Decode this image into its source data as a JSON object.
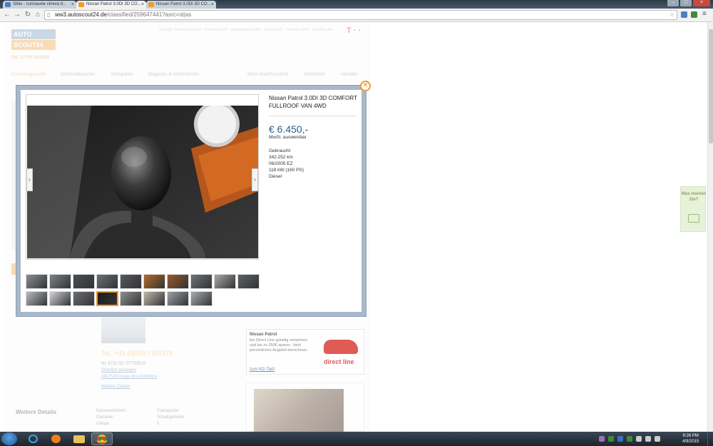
{
  "browser": {
    "tabs": [
      {
        "label": "Sibiu - curioasele cineva d..."
      },
      {
        "label": "Nissan Patrol 3.0DI 3D CO..."
      },
      {
        "label": "Nissan Patrol 3.0DI 3D CO..."
      }
    ],
    "url_host": "ww3.autoscout24.de",
    "url_path": "/classified/259647441?asrc=st|as"
  },
  "site": {
    "logo_top": "AUTO",
    "logo_bottom": "SCOUT24",
    "slogan": "DIE 1 FÜR DEINEN",
    "nav": [
      "Fahrzeugsuche",
      "Werkstattsuche",
      "Verkaufen",
      "Magazin & Informieren",
      "Mein AutoScout24",
      "Werkstatt",
      "Händler"
    ],
    "dealer": {
      "phone": "Tel.: +31 (0)318 / 591275",
      "address": "NL 6731 SC OTTERLO",
      "link1": "Standort anzeigen",
      "link2": "Alle Fahrzeuge des Anbieters",
      "link3": "Weitere Details"
    },
    "weitere_details": "Weitere Details",
    "specs": [
      {
        "k": "Karosserieform:",
        "v": "Transporter"
      },
      {
        "k": "Getriebe:",
        "v": "Schaltgetriebe"
      },
      {
        "k": "Gänge:",
        "v": "5"
      }
    ],
    "ad": {
      "title": "Nissan Patrol",
      "text": "bei Direct Line günstig versichern und bis zu 250€ sparen. Jetzt persönliches Angebot berechnen.",
      "brand": "direct line",
      "link": "zum Kfz-Tarif"
    },
    "feedback": "Was meinen Sie?"
  },
  "modal": {
    "title": "Nissan Patrol 3.0DI 3D COMFORT FULLROOF VAN 4WD",
    "price": "€ 6.450,-",
    "vat": "MwSt. ausweisbar",
    "details": [
      "Gebraucht",
      "342.252 km",
      "06/2005 EZ",
      "118 kW (160 PS)",
      "Diesel"
    ],
    "close": "×",
    "prev": "‹",
    "next": "›",
    "thumb_colors": [
      "#8a8f96",
      "#7c8088",
      "#4a4e54",
      "#6b6f75",
      "#55595e",
      "#b86a2c",
      "#9a5a2a",
      "#6f7378",
      "#a8a9ab",
      "#5e6266",
      "#b7bcc2",
      "#d0d3d6",
      "#6a6e72",
      "#1c1c1c",
      "#8d9094",
      "#c0b8ab",
      "#9aa2ab",
      "#a7acb1"
    ],
    "selected_thumb": 13
  },
  "taskbar": {
    "time": "9:26 PM",
    "date": "4/9/2015"
  }
}
